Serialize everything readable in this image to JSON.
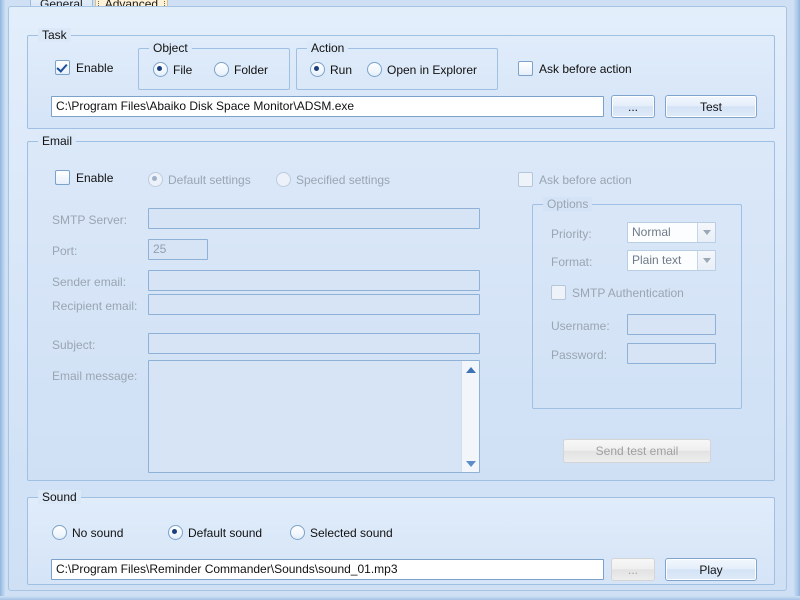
{
  "window": {
    "accent_color": "#cfe0f5",
    "panel_color": "#dbe8f8",
    "border_color": "#9fc0e2"
  },
  "tabs": [
    {
      "label": "General",
      "selected": false
    },
    {
      "label": "Advanced",
      "selected": true
    }
  ],
  "task": {
    "title": "Task",
    "enable_label": "Enable",
    "object": {
      "title": "Object",
      "options": [
        "File",
        "Folder"
      ],
      "selected": "File"
    },
    "action": {
      "title": "Action",
      "options": [
        "Run",
        "Open in Explorer"
      ],
      "selected": "Run"
    },
    "ask_before_action_label": "Ask before action",
    "path_value": "C:\\Program Files\\Abaiko Disk Space Monitor\\ADSM.exe",
    "browse_label": "...",
    "test_label": "Test"
  },
  "email": {
    "title": "Email",
    "enable_label": "Enable",
    "settings_options": [
      "Default settings",
      "Specified settings"
    ],
    "settings_selected": "Default settings",
    "ask_before_action_label": "Ask before action",
    "fields": [
      {
        "label": "SMTP Server:",
        "value": ""
      },
      {
        "label": "Port:",
        "value": "25"
      },
      {
        "label": "Sender email:",
        "value": ""
      },
      {
        "label": "Recipient email:",
        "value": ""
      },
      {
        "label": "Subject:",
        "value": ""
      },
      {
        "label": "Email message:",
        "value": ""
      }
    ],
    "options": {
      "title": "Options",
      "priority_label": "Priority:",
      "priority_value": "Normal",
      "format_label": "Format:",
      "format_value": "Plain text",
      "smtp_auth_label": "SMTP Authentication",
      "username_label": "Username:",
      "username_value": "",
      "password_label": "Password:",
      "password_value": ""
    },
    "send_test_label": "Send test email"
  },
  "sound": {
    "title": "Sound",
    "options": [
      "No sound",
      "Default sound",
      "Selected sound"
    ],
    "selected": "Default sound",
    "path_value": "C:\\Program Files\\Reminder Commander\\Sounds\\sound_01.mp3",
    "browse_label": "...",
    "play_label": "Play"
  }
}
